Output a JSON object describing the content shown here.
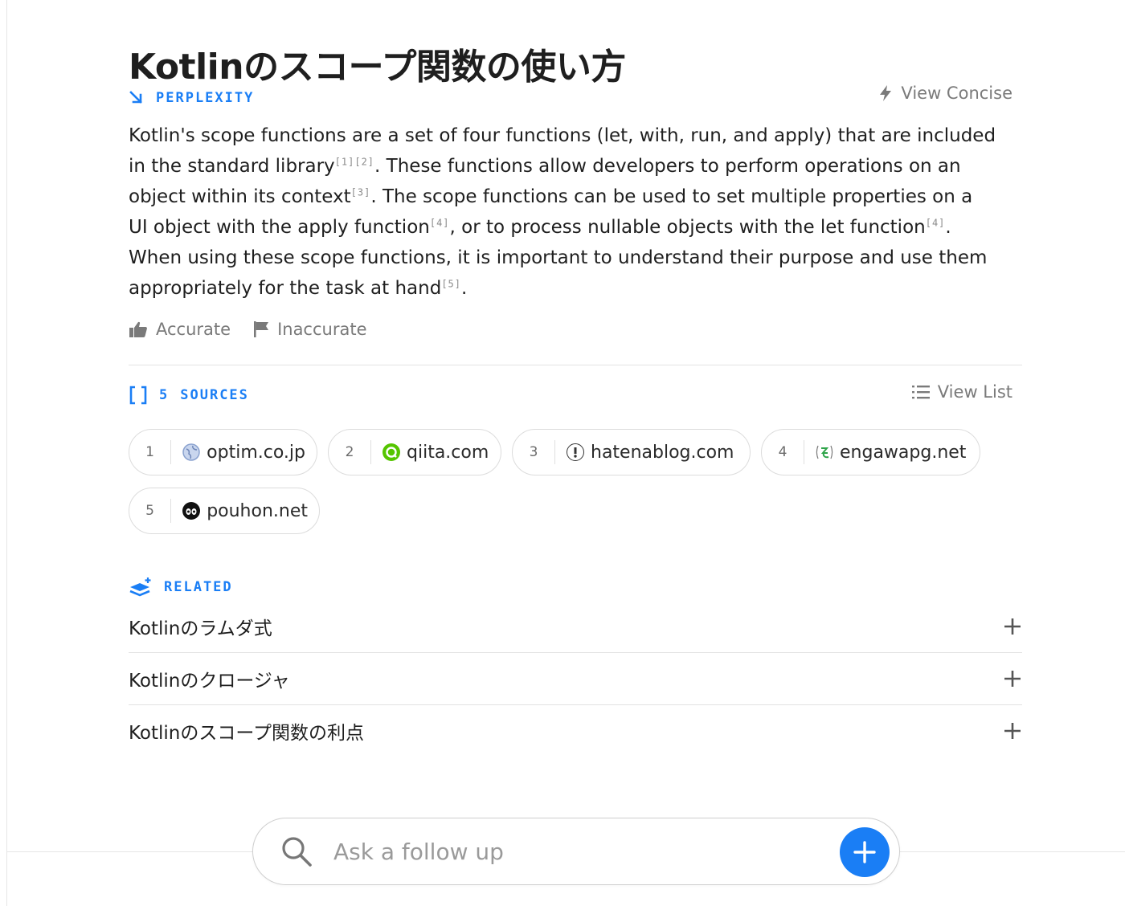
{
  "title": "Kotlinのスコープ関数の使い方",
  "answer_section": {
    "label": "PERPLEXITY",
    "view_concise_label": "View Concise",
    "segments": [
      {
        "text": "Kotlin's scope functions are a set of four functions (let, with, run, and apply) that are included in the standard library"
      },
      {
        "cite": "[1]"
      },
      {
        "cite": "[2]"
      },
      {
        "text": ". These functions allow developers to perform operations on an object within its context"
      },
      {
        "cite": "[3]"
      },
      {
        "text": ". The scope functions can be used to set multiple properties on a UI object with the apply function"
      },
      {
        "cite": "[4]"
      },
      {
        "text": ", or to process nullable objects with the let function"
      },
      {
        "cite": "[4]"
      },
      {
        "text": ". When using these scope functions, it is important to understand their purpose and use them appropriately for the task at hand"
      },
      {
        "cite": "[5]"
      },
      {
        "text": "."
      }
    ]
  },
  "feedback": {
    "accurate_label": "Accurate",
    "inaccurate_label": "Inaccurate"
  },
  "sources_section": {
    "count": "5",
    "label": "SOURCES",
    "view_list_label": "View List",
    "sources": [
      {
        "num": "1",
        "domain": "optim.co.jp",
        "icon": "globe-icon"
      },
      {
        "num": "2",
        "domain": "qiita.com",
        "icon": "qiita-icon"
      },
      {
        "num": "3",
        "domain": "hatenablog.com",
        "icon": "hatena-icon"
      },
      {
        "num": "4",
        "domain": "engawapg.net",
        "icon": "engawa-icon"
      },
      {
        "num": "5",
        "domain": "pouhon.net",
        "icon": "pouhon-icon"
      }
    ]
  },
  "related_section": {
    "label": "RELATED",
    "items": [
      {
        "label": "Kotlinのラムダ式"
      },
      {
        "label": "Kotlinのクロージャ"
      },
      {
        "label": "Kotlinのスコープ関数の利点"
      }
    ]
  },
  "ask": {
    "placeholder": "Ask a follow up"
  },
  "colors": {
    "accent": "#1a7ef5",
    "muted": "#7a7a7a"
  }
}
